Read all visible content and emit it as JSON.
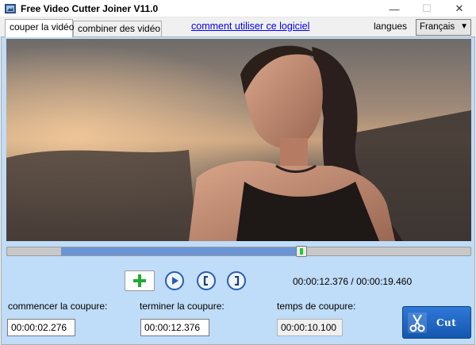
{
  "window": {
    "title": "Free Video Cutter Joiner V11.0",
    "minimize_glyph": "—",
    "maximize_glyph": "☐",
    "close_glyph": "✕"
  },
  "tabs": [
    {
      "label": "couper la vidéo",
      "active": true
    },
    {
      "label": "combiner des vidéo",
      "active": false
    }
  ],
  "help_link": "comment utiliser ce logiciel",
  "language": {
    "label": "langues",
    "selected": "Français"
  },
  "playback": {
    "position_fraction": 0.6355,
    "selection_start_fraction": 0.1169,
    "selection_end_fraction": 0.6355,
    "time_readout": "00:00:12.376 / 00:00:19.460"
  },
  "controls": {
    "add_icon": "plus-icon",
    "play_icon": "play-icon",
    "set_start_icon": "bracket-open-icon",
    "set_end_icon": "bracket-close-icon"
  },
  "cut": {
    "start_label": "commencer la coupure:",
    "start_value": "00:00:02.276",
    "end_label": "terminer la coupure:",
    "end_value": "00:00:12.376",
    "duration_label": "temps de coupure:",
    "duration_value": "00:00:10.100",
    "button_label": "Cut",
    "button_icon": "scissors-icon"
  },
  "colors": {
    "panel_bg": "#bfdcf8",
    "link": "#0000ee",
    "slider_fill": "#6b94d6",
    "cut_button": "#1e66c4",
    "control_border": "#2a5db0",
    "add_icon": "#22aa33"
  }
}
